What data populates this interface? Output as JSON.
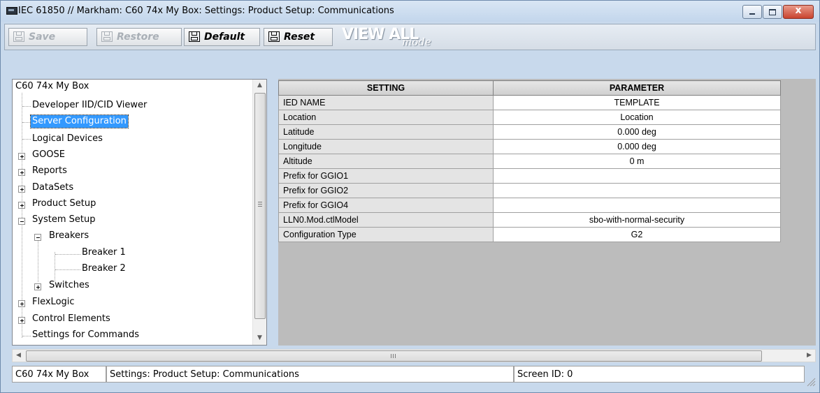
{
  "window": {
    "title": "IEC 61850 // Markham: C60 74x My Box: Settings: Product Setup: Communications",
    "minimize_icon": "minimize-icon",
    "maximize_icon": "maximize-icon",
    "close_icon": "close-icon",
    "close_glyph": "x"
  },
  "toolbar": {
    "save_label": "Save",
    "restore_label": "Restore",
    "default_label": "Default",
    "reset_label": "Reset",
    "view_all": "VIEW ALL",
    "view_mode": "mode"
  },
  "tree": {
    "root": "C60 74x My Box",
    "items": [
      {
        "label": "Developer IID/CID Viewer"
      },
      {
        "label": "Server Configuration"
      },
      {
        "label": "Logical Devices"
      },
      {
        "label": "GOOSE"
      },
      {
        "label": "Reports"
      },
      {
        "label": "DataSets"
      },
      {
        "label": "Product Setup"
      },
      {
        "label": "System Setup"
      },
      {
        "label": "Breakers"
      },
      {
        "label": "Breaker 1"
      },
      {
        "label": "Breaker 2"
      },
      {
        "label": "Switches"
      },
      {
        "label": "FlexLogic"
      },
      {
        "label": "Control Elements"
      },
      {
        "label": "Settings for Commands"
      }
    ],
    "selected": "Server Configuration"
  },
  "grid": {
    "headers": [
      "SETTING",
      "PARAMETER"
    ],
    "rows": [
      {
        "setting": "IED NAME",
        "parameter": "TEMPLATE"
      },
      {
        "setting": "Location",
        "parameter": "Location"
      },
      {
        "setting": "Latitude",
        "parameter": "0.000 deg"
      },
      {
        "setting": "Longitude",
        "parameter": "0.000 deg"
      },
      {
        "setting": "Altitude",
        "parameter": "0 m"
      },
      {
        "setting": "Prefix for GGIO1",
        "parameter": ""
      },
      {
        "setting": "Prefix for GGIO2",
        "parameter": ""
      },
      {
        "setting": "Prefix for GGIO4",
        "parameter": ""
      },
      {
        "setting": "LLN0.Mod.ctlModel",
        "parameter": "sbo-with-normal-security"
      },
      {
        "setting": "Configuration Type",
        "parameter": "G2"
      }
    ]
  },
  "status": {
    "device": "C60 74x My Box",
    "path": "Settings: Product Setup: Communications",
    "screen_id": "Screen ID: 0"
  },
  "scroll": {
    "hscroll_mark": "III"
  },
  "colors": {
    "title_bar": "#c8d9ec",
    "selection": "#3399ff",
    "grid_bg": "#bcbcbc",
    "close_button": "#c9442f"
  }
}
